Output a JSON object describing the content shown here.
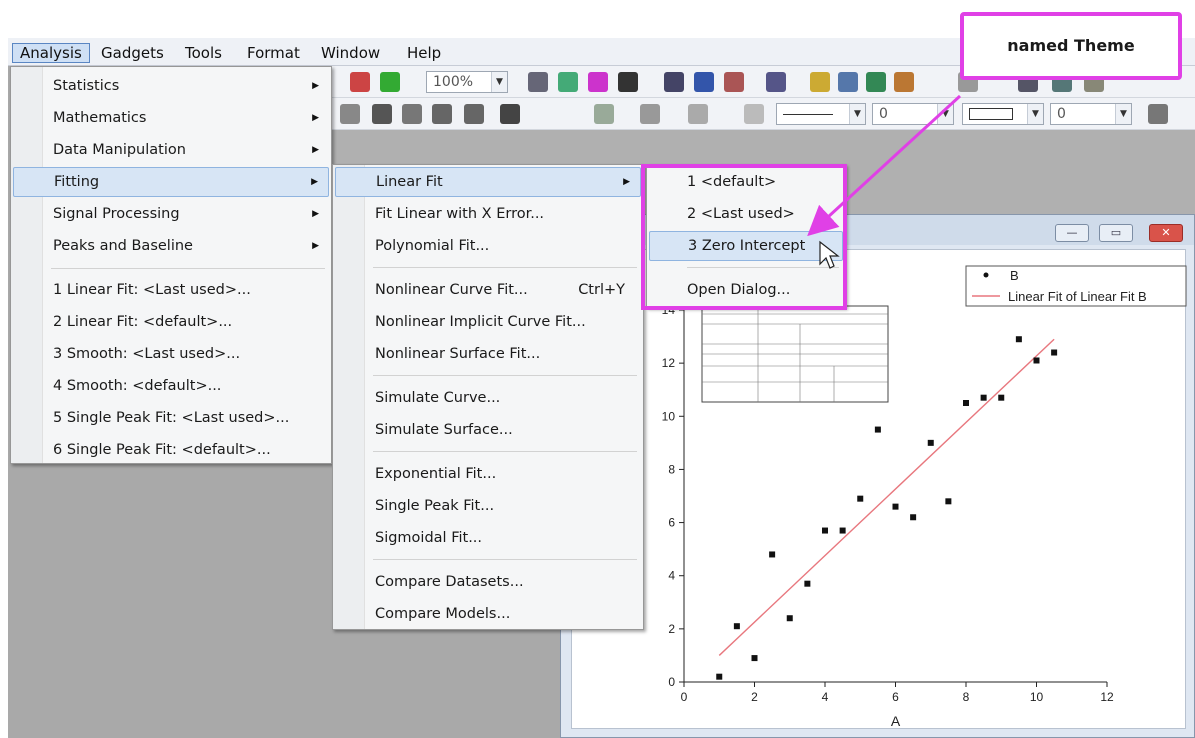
{
  "menubar": [
    "Analysis",
    "Gadgets",
    "Tools",
    "Format",
    "Window",
    "Help"
  ],
  "toolbar": {
    "zoom": "100%",
    "line_width": "0",
    "line_width2": "0"
  },
  "analysis_menu": {
    "items": [
      {
        "label": "Statistics",
        "submenu": true
      },
      {
        "label": "Mathematics",
        "submenu": true
      },
      {
        "label": "Data Manipulation",
        "submenu": true
      },
      {
        "label": "Fitting",
        "submenu": true
      },
      {
        "label": "Signal Processing",
        "submenu": true
      },
      {
        "label": "Peaks and Baseline",
        "submenu": true
      }
    ],
    "recent": [
      "1 Linear Fit: <Last used>...",
      "2 Linear Fit: <default>...",
      "3 Smooth: <Last used>...",
      "4 Smooth: <default>...",
      "5 Single Peak Fit: <Last used>...",
      "6 Single Peak Fit: <default>..."
    ]
  },
  "fitting_menu": {
    "items": [
      "Linear Fit",
      "Fit Linear with X Error...",
      "Polynomial Fit...",
      "Nonlinear Curve Fit...",
      "Nonlinear Implicit Curve Fit...",
      "Nonlinear Surface Fit...",
      "Simulate Curve...",
      "Simulate Surface...",
      "Exponential Fit...",
      "Single Peak Fit...",
      "Sigmoidal Fit...",
      "Compare Datasets...",
      "Compare Models..."
    ],
    "shortcut": "Ctrl+Y"
  },
  "linearfit_menu": {
    "items": [
      "1 <default>",
      "2 <Last used>",
      "3 Zero Intercept",
      "Open Dialog..."
    ]
  },
  "annotation": {
    "label": "named Theme",
    "color": "#e040e6"
  },
  "chart_data": {
    "type": "scatter",
    "xlabel": "A",
    "ylabel": "",
    "xlim": [
      0,
      12
    ],
    "ylim": [
      0,
      14
    ],
    "xticks": [
      0,
      2,
      4,
      6,
      8,
      10,
      12
    ],
    "yticks": [
      0,
      2,
      4,
      6,
      8,
      10,
      12,
      14
    ],
    "legend": [
      "B",
      "Linear Fit of Linear Fit B"
    ],
    "legend_position": "top-right",
    "series": [
      {
        "name": "B",
        "x": [
          1,
          1.5,
          2,
          2.5,
          3,
          3.5,
          4,
          4.5,
          5,
          5.5,
          6,
          6.5,
          7,
          7.5,
          8,
          8.5,
          9,
          9.5,
          10,
          10.5
        ],
        "y": [
          0.2,
          2.1,
          0.9,
          4.8,
          2.4,
          3.7,
          5.7,
          5.7,
          6.9,
          9.5,
          6.6,
          6.2,
          9.0,
          6.8,
          10.5,
          10.7,
          10.7,
          12.9,
          12.1,
          12.4
        ]
      }
    ],
    "fit_line": {
      "x": [
        1,
        10.5
      ],
      "y": [
        1.0,
        12.9
      ],
      "color": "#e8777e"
    },
    "marker_color": "#111111"
  }
}
